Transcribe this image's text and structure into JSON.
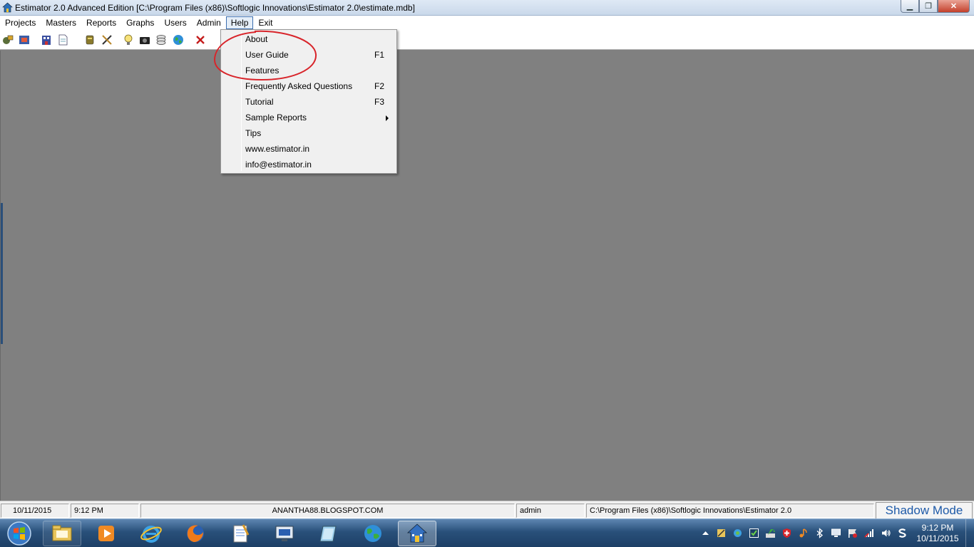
{
  "window": {
    "title": "Estimator 2.0 Advanced Edition  [C:\\Program Files (x86)\\Softlogic Innovations\\Estimator 2.0\\estimate.mdb]",
    "minimize_glyph": "▁",
    "restore_glyph": "❐",
    "close_glyph": "✕"
  },
  "menubar": {
    "items": [
      "Projects",
      "Masters",
      "Reports",
      "Graphs",
      "Users",
      "Admin",
      "Help",
      "Exit"
    ],
    "active": "Help"
  },
  "toolbar": {
    "icons": [
      "projects-icon",
      "estimate-icon",
      "building-icon",
      "document-icon",
      "materials-icon",
      "tools-icon",
      "bulb-icon",
      "camera-icon",
      "stack-icon",
      "globe-icon",
      "close-x-icon"
    ]
  },
  "help_menu": {
    "items": [
      {
        "label": "About",
        "shortcut": ""
      },
      {
        "label": "User Guide",
        "shortcut": "F1"
      },
      {
        "label": "Features",
        "shortcut": ""
      },
      {
        "label": "Frequently Asked Questions",
        "shortcut": "F2"
      },
      {
        "label": "Tutorial",
        "shortcut": "F3"
      },
      {
        "label": "Sample Reports",
        "shortcut": "",
        "submenu": true
      },
      {
        "label": "Tips",
        "shortcut": ""
      },
      {
        "label": "www.estimator.in",
        "shortcut": ""
      },
      {
        "label": "info@estimator.in",
        "shortcut": ""
      }
    ],
    "annotation_color": "#d8242a"
  },
  "statusbar": {
    "date": "10/11/2015",
    "time": "9:12 PM",
    "site": "ANANTHA88.BLOGSPOT.COM",
    "user": "admin",
    "path": "C:\\Program Files (x86)\\Softlogic Innovations\\Estimator 2.0",
    "shadow_button": "Shadow Mode"
  },
  "taskbar": {
    "apps": [
      "file-explorer-icon",
      "media-player-icon",
      "internet-explorer-icon",
      "firefox-icon",
      "notepad-icon",
      "remote-desktop-icon",
      "app-window-icon",
      "globe-app-icon",
      "estimator-icon"
    ],
    "active_app": "estimator-icon",
    "clock_time": "9:12 PM",
    "clock_date": "10/11/2015"
  }
}
